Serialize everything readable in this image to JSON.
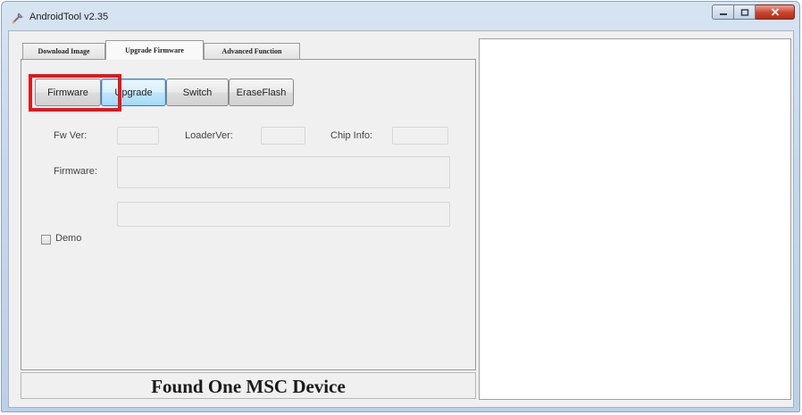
{
  "window": {
    "title": "AndroidTool v2.35"
  },
  "icons": {
    "app": "tool-icon",
    "minimize": "minimize-icon",
    "maximize": "maximize-icon",
    "close": "close-icon"
  },
  "tabs": [
    {
      "label": "Download Image",
      "active": false
    },
    {
      "label": "Upgrade Firmware",
      "active": true
    },
    {
      "label": "Advanced Function",
      "active": false
    }
  ],
  "buttons": {
    "firmware": "Firmware",
    "upgrade": "Upgrade",
    "switch": "Switch",
    "erase_flash": "EraseFlash"
  },
  "info": {
    "fw_ver_label": "Fw Ver:",
    "fw_ver_value": "",
    "loader_ver_label": "LoaderVer:",
    "loader_ver_value": "",
    "chip_info_label": "Chip Info:",
    "chip_info_value": "",
    "firmware_label": "Firmware:",
    "firmware_value": ""
  },
  "demo": {
    "label": "Demo",
    "checked": false,
    "value": ""
  },
  "status": {
    "message": "Found One MSC Device"
  },
  "colors": {
    "highlight": "#e5161b",
    "focus": "#3c7fb1",
    "close_button": "#c8432d"
  }
}
